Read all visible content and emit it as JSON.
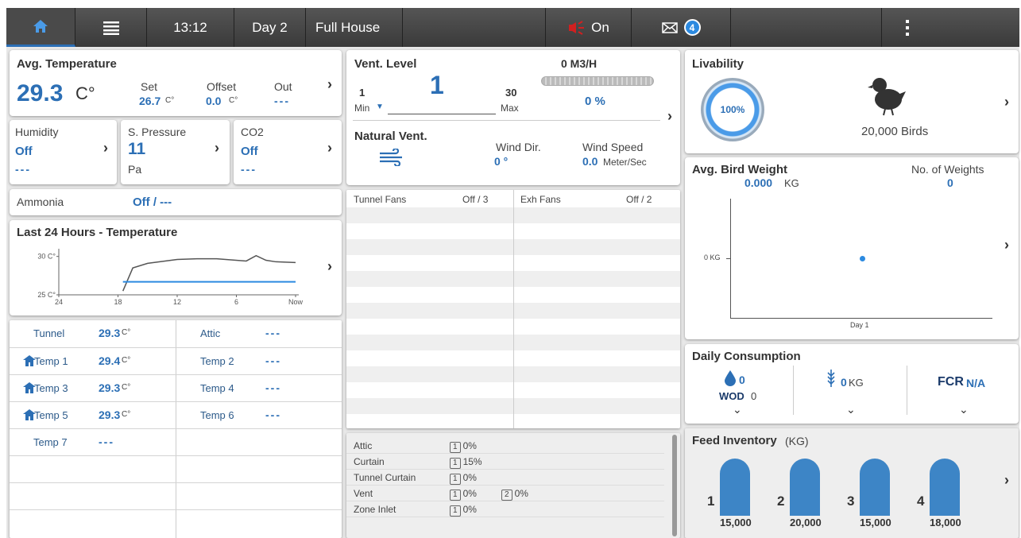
{
  "topbar": {
    "time": "13:12",
    "day": "Day 2",
    "mode": "Full House",
    "alarm": "On",
    "messages": "4"
  },
  "avg_temp": {
    "title": "Avg. Temperature",
    "value": "29.3",
    "unit": "C°",
    "set_label": "Set",
    "set_value": "26.7",
    "offset_label": "Offset",
    "offset_value": "0.0",
    "unit_small": "C°",
    "out_label": "Out",
    "out_value": "---"
  },
  "humidity": {
    "label": "Humidity",
    "value": "Off",
    "sub": "---"
  },
  "pressure": {
    "label": "S. Pressure",
    "value": "11",
    "unit": "Pa"
  },
  "co2": {
    "label": "CO2",
    "value": "Off",
    "sub": "---"
  },
  "ammonia": {
    "label": "Ammonia",
    "value": "Off / ---"
  },
  "last24": {
    "title": "Last 24 Hours - Temperature"
  },
  "chart_data": {
    "type": "line",
    "title": "Last 24 Hours - Temperature",
    "x_ticks": [
      "24",
      "18",
      "12",
      "6",
      "Now"
    ],
    "y_ticks": [
      "30 C°",
      "25 C°"
    ],
    "ylim": [
      25,
      31
    ],
    "xlim": [
      24,
      0
    ],
    "series": [
      {
        "x": [
          17.5,
          16.5,
          15,
          12,
          10,
          8,
          5,
          4,
          3,
          2,
          0
        ],
        "values": [
          25.5,
          28.5,
          29.1,
          29.6,
          29.7,
          29.7,
          29.4,
          30.1,
          29.5,
          29.3,
          29.2
        ],
        "color": "#555555"
      },
      {
        "x": [
          17.5,
          0
        ],
        "values": [
          26.7,
          26.7
        ],
        "color": "#2c8ae0"
      }
    ]
  },
  "temps": [
    {
      "name": "Tunnel",
      "value": "29.3",
      "unit": "C°",
      "icon": false,
      "name2": "Attic",
      "value2": "---"
    },
    {
      "name": "Temp 1",
      "value": "29.4",
      "unit": "C°",
      "icon": true,
      "name2": "Temp 2",
      "value2": "---"
    },
    {
      "name": "Temp 3",
      "value": "29.3",
      "unit": "C°",
      "icon": true,
      "name2": "Temp 4",
      "value2": "---"
    },
    {
      "name": "Temp 5",
      "value": "29.3",
      "unit": "C°",
      "icon": true,
      "name2": "Temp 6",
      "value2": "---"
    },
    {
      "name": "Temp 7",
      "value": "---",
      "unit": "",
      "icon": false,
      "name2": "",
      "value2": ""
    }
  ],
  "vent": {
    "title": "Vent. Level",
    "value": "1",
    "flow": "0 M3/H",
    "min_val": "1",
    "min_label": "Min",
    "max_val": "30",
    "max_label": "Max",
    "percent": "0 %"
  },
  "natural": {
    "title": "Natural Vent.",
    "wind_dir_label": "Wind Dir.",
    "wind_dir": "0 °",
    "wind_speed_label": "Wind Speed",
    "wind_speed": "0.0",
    "wind_speed_unit": "Meter/Sec"
  },
  "fans": {
    "tunnel_label": "Tunnel Fans",
    "tunnel_value": "Off / 3",
    "exh_label": "Exh Fans",
    "exh_value": "Off / 2"
  },
  "inlets": [
    {
      "name": "Attic",
      "n1": "1",
      "v1": "0%",
      "n2": "",
      "v2": ""
    },
    {
      "name": "Curtain",
      "n1": "1",
      "v1": "15%",
      "n2": "",
      "v2": ""
    },
    {
      "name": "Tunnel Curtain",
      "n1": "1",
      "v1": "0%",
      "n2": "",
      "v2": ""
    },
    {
      "name": "Vent",
      "n1": "1",
      "v1": "0%",
      "n2": "2",
      "v2": "0%"
    },
    {
      "name": "Zone Inlet",
      "n1": "1",
      "v1": "0%",
      "n2": "",
      "v2": ""
    }
  ],
  "livability": {
    "title": "Livability",
    "percent": "100%",
    "birds": "20,000 Birds"
  },
  "weight": {
    "title": "Avg. Bird Weight",
    "value": "0.000",
    "unit": "KG",
    "count_label": "No. of Weights",
    "count": "0",
    "y_tick": "0 KG",
    "x_tick": "Day 1"
  },
  "consumption": {
    "title": "Daily Consumption",
    "water_value": "0",
    "wod_label": "WOD",
    "wod_value": "0",
    "feed_value": "0",
    "feed_unit": "KG",
    "fcr_label": "FCR",
    "fcr_value": "N/A"
  },
  "feed": {
    "title": "Feed Inventory",
    "unit": "(KG)",
    "bins": [
      {
        "id": "1",
        "amount": "15,000"
      },
      {
        "id": "2",
        "amount": "20,000"
      },
      {
        "id": "3",
        "amount": "15,000"
      },
      {
        "id": "4",
        "amount": "18,000"
      }
    ]
  }
}
